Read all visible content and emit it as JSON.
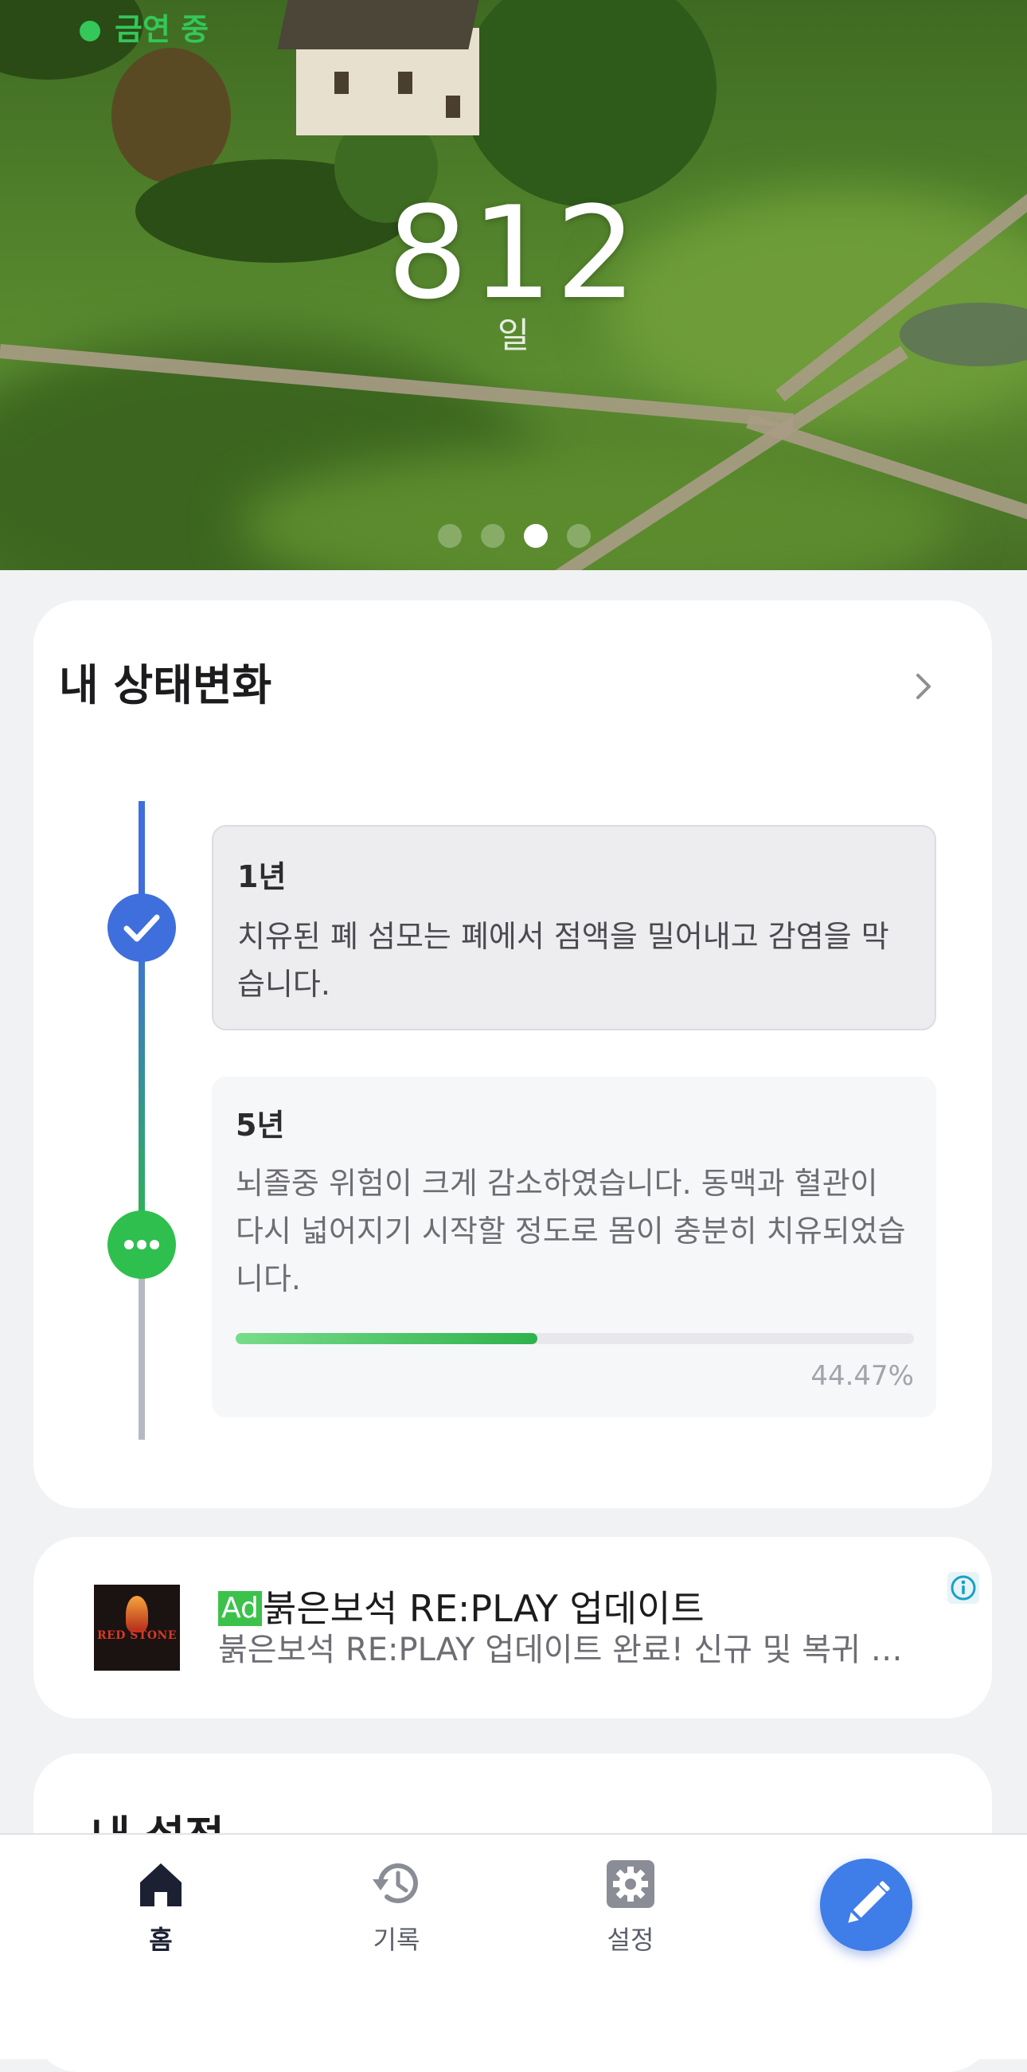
{
  "hero": {
    "status_text": "금연 중",
    "days_value": "812",
    "days_unit": "일",
    "page_dots_count": 4,
    "page_active_index": 2,
    "status_color": "#34c759"
  },
  "status_card": {
    "title": "내 상태변화",
    "milestones": [
      {
        "period": "1년",
        "description": "치유된 폐 섬모는 폐에서 점액을 밀어내고 감염을 막습니다.",
        "state": "completed"
      },
      {
        "period": "5년",
        "description": "뇌졸중 위험이 크게 감소하였습니다. 동맥과 혈관이 다시 넓어지기 시작할 정도로 몸이 충분히 치유되었습니다.",
        "state": "in-progress",
        "progress_percent": 44.47,
        "progress_label": "44.47%"
      }
    ],
    "colors": {
      "completed": "#3f6fdc",
      "in_progress": "#2fbf4f",
      "pending": "#b6b9c2"
    }
  },
  "ad": {
    "badge": "Ad",
    "title": "붉은보석 RE:PLAY 업데이트",
    "description": "붉은보석 RE:PLAY 업데이트 완료! 신규 및 복귀 유…",
    "thumbnail_text": "RED STONE"
  },
  "next_card": {
    "title": "내 설정"
  },
  "bottom_nav": {
    "items": [
      {
        "label": "홈",
        "icon": "home-icon",
        "active": true
      },
      {
        "label": "기록",
        "icon": "history-icon",
        "active": false
      },
      {
        "label": "설정",
        "icon": "gear-icon",
        "active": false
      }
    ],
    "fab_icon": "pencil-icon",
    "accent_color": "#3f7de8"
  }
}
